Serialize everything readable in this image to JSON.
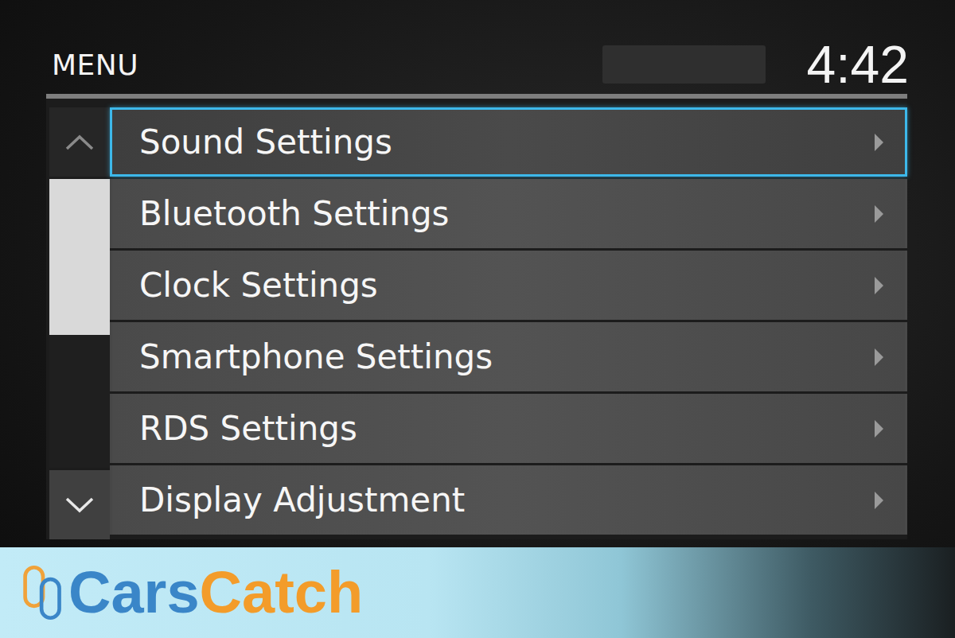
{
  "header": {
    "title": "MENU",
    "time": "4:42"
  },
  "scrollbar": {
    "level": 0.54
  },
  "menu": {
    "items": [
      {
        "label": "Sound Settings",
        "selected": true
      },
      {
        "label": "Bluetooth Settings",
        "selected": false
      },
      {
        "label": "Clock Settings",
        "selected": false
      },
      {
        "label": "Smartphone Settings",
        "selected": false
      },
      {
        "label": "RDS Settings",
        "selected": false
      },
      {
        "label": "Display Adjustment",
        "selected": false
      }
    ]
  },
  "watermark": {
    "words": [
      {
        "text": "Cars"
      },
      {
        "text": "Catch"
      }
    ]
  }
}
